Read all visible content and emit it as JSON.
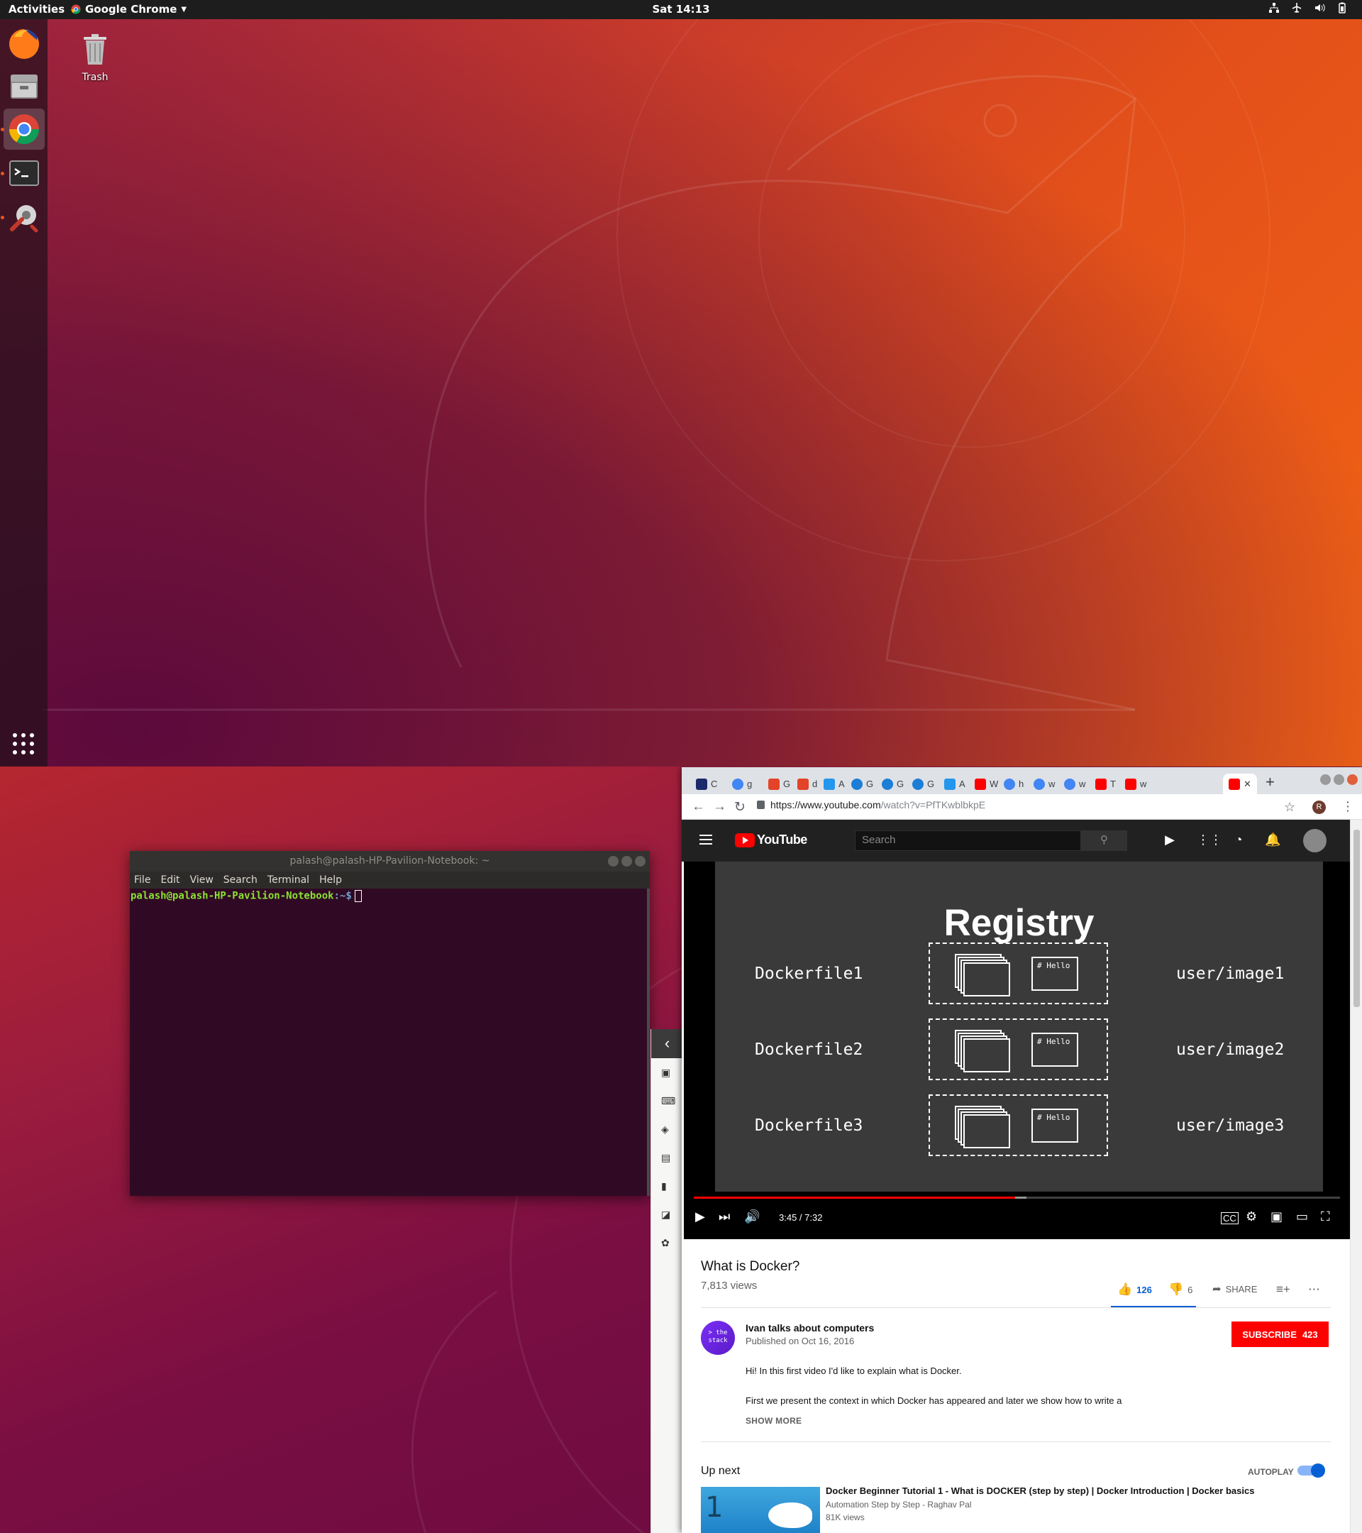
{
  "topbar": {
    "activities": "Activities",
    "app_menu": "Google Chrome",
    "clock": "Sat 14:13"
  },
  "desktop": {
    "trash_label": "Trash"
  },
  "dock": {
    "items": [
      "firefox-icon",
      "files-icon",
      "chrome-icon",
      "terminal-icon",
      "software-updater-icon"
    ],
    "show_apps": "apps-grid-icon"
  },
  "terminal": {
    "title": "palash@palash-HP-Pavilion-Notebook: ~",
    "menu": [
      "File",
      "Edit",
      "View",
      "Search",
      "Terminal",
      "Help"
    ],
    "prompt_user": "palash@palash-HP-Pavilion-Notebook",
    "prompt_path": ":~$"
  },
  "chrome": {
    "tabs": [
      "C",
      "g",
      "G",
      "d",
      "A",
      "G",
      "G",
      "G",
      "A",
      "W",
      "h",
      "w",
      "w",
      "T",
      "w"
    ],
    "url_host": "https://www.youtube.com",
    "url_path": "/watch?v=PfTKwblbkpE",
    "profile_initial": "R"
  },
  "youtube": {
    "logo_text": "YouTube",
    "search_placeholder": "Search",
    "slide": {
      "title": "Registry",
      "hello_text": "# Hello",
      "rows": [
        {
          "dockerfile": "Dockerfile1",
          "image": "user/image1"
        },
        {
          "dockerfile": "Dockerfile2",
          "image": "user/image2"
        },
        {
          "dockerfile": "Dockerfile3",
          "image": "user/image3"
        }
      ]
    },
    "player": {
      "time": "3:45 / 7:32",
      "played_fraction": 0.497,
      "loaded_fraction": 0.515
    },
    "video": {
      "title": "What is Docker?",
      "views": "7,813 views",
      "likes": "126",
      "dislikes": "6",
      "share": "SHARE"
    },
    "channel": {
      "avatar_text": "> the stack",
      "name": "Ivan talks about computers",
      "published": "Published on Oct 16, 2016",
      "subscribe_label": "SUBSCRIBE",
      "subscriber_count": "423"
    },
    "description": {
      "line1": "Hi! In this first video I'd like to explain what is Docker.",
      "line2": "First we present the context in which Docker has appeared and later we show how to write a",
      "show_more": "SHOW MORE"
    },
    "up_next": {
      "heading": "Up next",
      "autoplay_label": "AUTOPLAY",
      "item": {
        "thumb_number": "1",
        "title": "Docker Beginner Tutorial 1 - What is DOCKER (step by step) | Docker Introduction | Docker basics",
        "channel": "Automation Step by Step - Raghav Pal",
        "views": "81K views"
      }
    }
  }
}
